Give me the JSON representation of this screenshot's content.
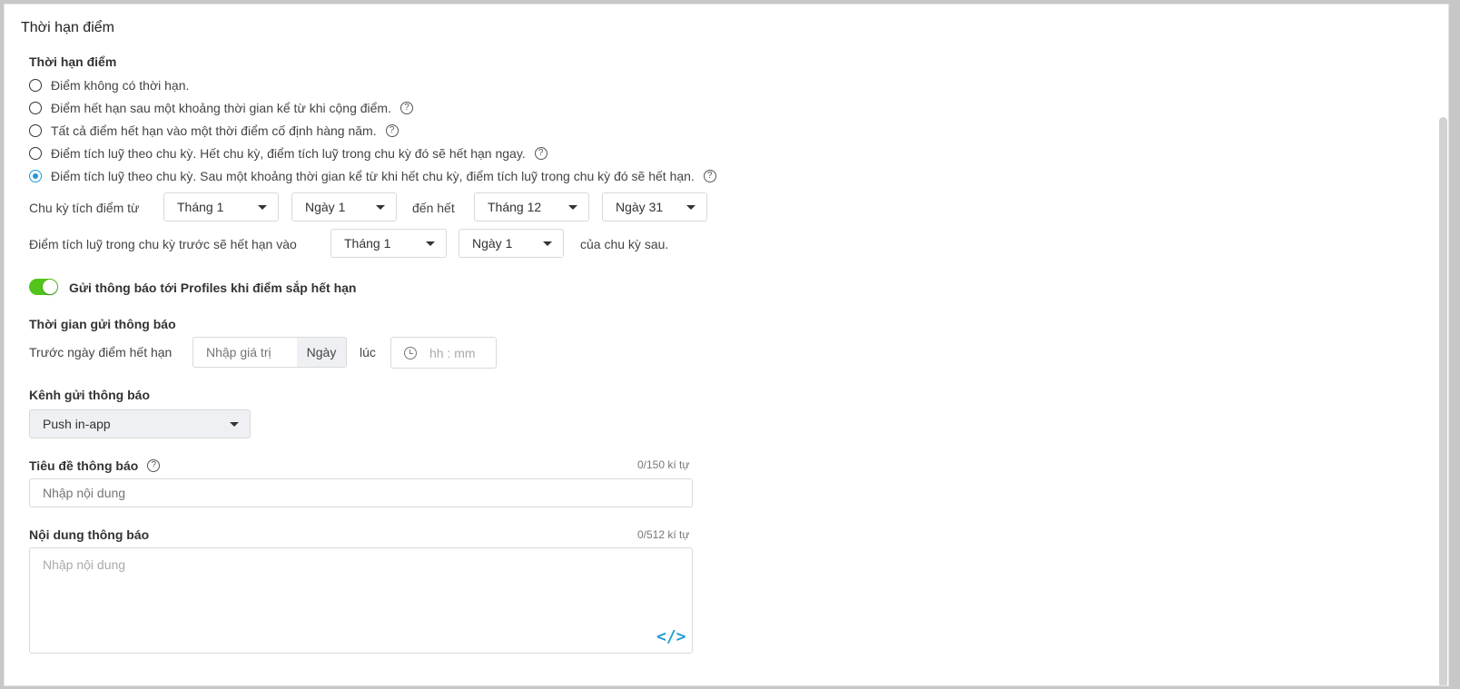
{
  "section_title": "Thời hạn điểm",
  "expiry": {
    "label": "Thời hạn điểm",
    "options": [
      {
        "label": "Điểm không có thời hạn.",
        "checked": false,
        "help": false
      },
      {
        "label": "Điểm hết hạn sau một khoảng thời gian kể từ khi cộng điểm.",
        "checked": false,
        "help": true
      },
      {
        "label": "Tất cả điểm hết hạn vào một thời điểm cố định hàng năm.",
        "checked": false,
        "help": true
      },
      {
        "label": "Điểm tích luỹ theo chu kỳ. Hết chu kỳ, điểm tích luỹ trong chu kỳ đó sẽ hết hạn ngay.",
        "checked": false,
        "help": true
      },
      {
        "label": "Điểm tích luỹ theo chu kỳ. Sau một khoảng thời gian kể từ khi hết chu kỳ, điểm tích luỹ trong chu kỳ đó sẽ hết hạn.",
        "checked": true,
        "help": true
      }
    ]
  },
  "cycle": {
    "from_label": "Chu kỳ tích điểm từ",
    "from_month": "Tháng 1",
    "from_day": "Ngày 1",
    "to_label": "đến hết",
    "to_month": "Tháng 12",
    "to_day": "Ngày 31"
  },
  "prev_cycle": {
    "label": "Điểm tích luỹ trong chu kỳ trước sẽ hết hạn vào",
    "month": "Tháng 1",
    "day": "Ngày 1",
    "suffix": "của chu kỳ sau."
  },
  "notify": {
    "toggle_on": true,
    "toggle_label": "Gửi thông báo tới Profiles khi điểm sắp hết hạn",
    "time_title": "Thời gian gửi thông báo",
    "before_label": "Trước ngày điểm hết hạn",
    "value_placeholder": "Nhập giá trị",
    "unit": "Ngày",
    "at_label": "lúc",
    "time_placeholder": "hh : mm"
  },
  "channel": {
    "label": "Kênh gửi thông báo",
    "value": "Push in-app"
  },
  "title_field": {
    "label": "Tiêu đề thông báo",
    "counter": "0/150 kí tự",
    "placeholder": "Nhập nội dung"
  },
  "content_field": {
    "label": "Nội dung thông báo",
    "counter": "0/512 kí tự",
    "placeholder": "Nhập nội dung",
    "code_icon": "</>"
  },
  "colors": {
    "accent": "#1f9ad6",
    "toggle": "#52c41a"
  }
}
